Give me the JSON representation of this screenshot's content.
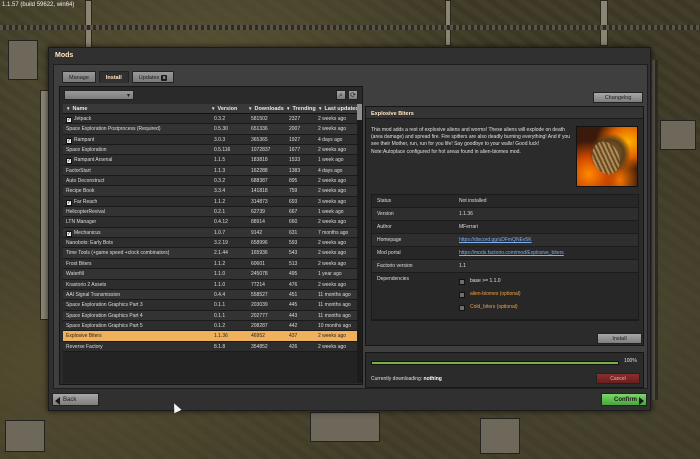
{
  "app": {
    "version_label": "1.1.57 (build 59622, win64)",
    "window_title": "Mods"
  },
  "tabs": [
    {
      "label": "Manage",
      "active": false
    },
    {
      "label": "Install",
      "active": true
    },
    {
      "label": "Updates",
      "active": false,
      "badge": "6"
    }
  ],
  "table": {
    "headers": {
      "name": "Name",
      "version": "Version",
      "downloads": "Downloads",
      "trending": "Trending",
      "last_updated": "Last updated"
    },
    "rows": [
      {
        "name": "Jetpack",
        "checked": true,
        "version": "0.3.2",
        "downloads": "581502",
        "trending": "2327",
        "updated": "2 weeks ago"
      },
      {
        "name": "Space Exploration Postprocess (Required)",
        "checked": false,
        "version": "0.5.30",
        "downloads": "651336",
        "trending": "2007",
        "updated": "2 weeks ago"
      },
      {
        "name": "Rampant",
        "checked": true,
        "version": "3.0.3",
        "downloads": "365365",
        "trending": "1927",
        "updated": "4 days ago"
      },
      {
        "name": "Space Exploration",
        "checked": false,
        "version": "0.5.116",
        "downloads": "1072837",
        "trending": "1677",
        "updated": "2 weeks ago"
      },
      {
        "name": "Rampant Arsenal",
        "checked": true,
        "version": "1.1.5",
        "downloads": "183818",
        "trending": "1533",
        "updated": "1 week ago"
      },
      {
        "name": "FactorStart",
        "checked": false,
        "version": "1.1.3",
        "downloads": "162288",
        "trending": "1383",
        "updated": "4 days ago"
      },
      {
        "name": "Auto Deconstruct",
        "checked": false,
        "version": "0.3.2",
        "downloads": "688387",
        "trending": "895",
        "updated": "2 weeks ago"
      },
      {
        "name": "Recipe Book",
        "checked": false,
        "version": "3.3.4",
        "downloads": "141818",
        "trending": "759",
        "updated": "2 weeks ago"
      },
      {
        "name": "Far Reach",
        "checked": true,
        "version": "1.1.2",
        "downloads": "314873",
        "trending": "693",
        "updated": "3 weeks ago"
      },
      {
        "name": "HelicopterRevival",
        "checked": false,
        "version": "0.2.1",
        "downloads": "62739",
        "trending": "667",
        "updated": "1 week ago"
      },
      {
        "name": "LTN Manager",
        "checked": false,
        "version": "0.4.12",
        "downloads": "88914",
        "trending": "660",
        "updated": "2 weeks ago"
      },
      {
        "name": "Mechanicus",
        "checked": true,
        "version": "1.0.7",
        "downloads": "9142",
        "trending": "631",
        "updated": "7 months ago"
      },
      {
        "name": "Nanobots: Early Bots",
        "checked": false,
        "version": "3.2.19",
        "downloads": "658996",
        "trending": "593",
        "updated": "2 weeks ago"
      },
      {
        "name": "Time Tools (+game speed +clock combinators)",
        "checked": false,
        "version": "2.1.44",
        "downloads": "165936",
        "trending": "543",
        "updated": "2 weeks ago"
      },
      {
        "name": "Frost Biters",
        "checked": false,
        "version": "1.1.2",
        "downloads": "60601",
        "trending": "513",
        "updated": "2 weeks ago"
      },
      {
        "name": "Waterfill",
        "checked": false,
        "version": "1.1.0",
        "downloads": "245078",
        "trending": "495",
        "updated": "1 year ago"
      },
      {
        "name": "Krastorio 2 Assets",
        "checked": false,
        "version": "1.1.0",
        "downloads": "77214",
        "trending": "476",
        "updated": "2 weeks ago"
      },
      {
        "name": "AAI Signal Transmission",
        "checked": false,
        "version": "0.4.4",
        "downloads": "558527",
        "trending": "451",
        "updated": "11 months ago"
      },
      {
        "name": "Space Exploration Graphics Part 3",
        "checked": false,
        "version": "0.1.1",
        "downloads": "203039",
        "trending": "445",
        "updated": "11 months ago"
      },
      {
        "name": "Space Exploration Graphics Part 4",
        "checked": false,
        "version": "0.1.1",
        "downloads": "202777",
        "trending": "443",
        "updated": "11 months ago"
      },
      {
        "name": "Space Exploration Graphics Part 5",
        "checked": false,
        "version": "0.1.2",
        "downloads": "208287",
        "trending": "442",
        "updated": "10 months ago"
      },
      {
        "name": "Explosive Biters",
        "checked": false,
        "version": "1.1.36",
        "downloads": "46952",
        "trending": "437",
        "updated": "2 weeks ago",
        "selected": true
      },
      {
        "name": "Reverse Factory",
        "checked": false,
        "version": "8.1.8",
        "downloads": "354852",
        "trending": "426",
        "updated": "2 weeks ago"
      }
    ]
  },
  "detail": {
    "changelog_label": "Changelog",
    "title": "Explosive Biters",
    "description": "This mod adds a rest of explosive aliens and worms! These aliens will explode on death (area damage) and spread fire. Fire spitters are also deadly burning everything! And if you see their Mother, run, run for you life! Say goodbye to your walls! Good luck! Note:Autoplace configured for hot areas found in alien-biomes mod.",
    "info": [
      {
        "key": "Status",
        "value": "Not installed"
      },
      {
        "key": "Version",
        "value": "1.1.36"
      },
      {
        "key": "Author",
        "value": "MFerrari"
      },
      {
        "key": "Homepage",
        "value": "https://discord.gg/uDFmQNEv5K",
        "link": true
      },
      {
        "key": "Mod portal",
        "value": "https://mods.factorio.com/mod/Explosive_biters",
        "link": true
      },
      {
        "key": "Factorio version",
        "value": "1.1"
      }
    ],
    "dependencies_label": "Dependencies",
    "dependencies": [
      {
        "text": "base >= 1.1.0",
        "optional": false
      },
      {
        "text": "alien-biomes (optional)",
        "optional": true
      },
      {
        "text": "Cold_biters (optional)",
        "optional": true
      }
    ],
    "install_label": "Install"
  },
  "download": {
    "progress_percent": 100,
    "percent_label": "100%",
    "current_label": "Currently downloading:",
    "current_value": "nothing",
    "cancel_label": "Cancel"
  },
  "footer": {
    "back_label": "Back",
    "confirm_label": "Confirm"
  }
}
